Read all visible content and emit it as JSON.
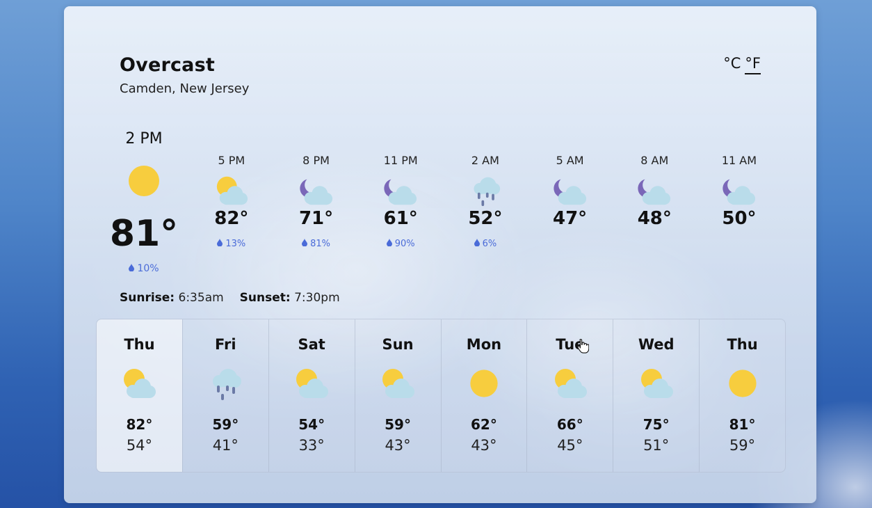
{
  "current": {
    "condition": "Overcast",
    "location": "Camden, New Jersey",
    "time": "2 PM",
    "icon": "sun-icon",
    "temp": "81°",
    "precip": "10%"
  },
  "units": {
    "celsius": "°C",
    "fahrenheit": "°F",
    "selected": "°F"
  },
  "hourly": [
    {
      "time": "5 PM",
      "icon": "partly-cloudy-day-icon",
      "temp": "82°",
      "precip": "13%"
    },
    {
      "time": "8 PM",
      "icon": "partly-cloudy-night-icon",
      "temp": "71°",
      "precip": "81%"
    },
    {
      "time": "11 PM",
      "icon": "partly-cloudy-night-icon",
      "temp": "61°",
      "precip": "90%"
    },
    {
      "time": "2 AM",
      "icon": "rain-icon",
      "temp": "52°",
      "precip": "6%"
    },
    {
      "time": "5 AM",
      "icon": "partly-cloudy-night-icon",
      "temp": "47°",
      "precip": ""
    },
    {
      "time": "8 AM",
      "icon": "partly-cloudy-night-icon",
      "temp": "48°",
      "precip": ""
    },
    {
      "time": "11 AM",
      "icon": "partly-cloudy-night-icon",
      "temp": "50°",
      "precip": ""
    }
  ],
  "sun": {
    "sunrise_label": "Sunrise:",
    "sunrise": "6:35am",
    "sunset_label": "Sunset:",
    "sunset": "7:30pm"
  },
  "daily": [
    {
      "day": "Thu",
      "icon": "partly-cloudy-day-icon",
      "high": "82°",
      "low": "54°"
    },
    {
      "day": "Fri",
      "icon": "rain-icon",
      "high": "59°",
      "low": "41°"
    },
    {
      "day": "Sat",
      "icon": "partly-cloudy-day-icon",
      "high": "54°",
      "low": "33°"
    },
    {
      "day": "Sun",
      "icon": "partly-cloudy-day-icon",
      "high": "59°",
      "low": "43°"
    },
    {
      "day": "Mon",
      "icon": "sun-icon",
      "high": "62°",
      "low": "43°"
    },
    {
      "day": "Tue",
      "icon": "partly-cloudy-day-icon",
      "high": "66°",
      "low": "45°"
    },
    {
      "day": "Wed",
      "icon": "partly-cloudy-day-icon",
      "high": "75°",
      "low": "51°"
    },
    {
      "day": "Thu",
      "icon": "sun-icon",
      "high": "81°",
      "low": "59°"
    }
  ],
  "colors": {
    "sun": "#f7cd3e",
    "cloud": "#b9dcea",
    "moon": "#7a67b8",
    "rain": "#6b7aa6",
    "precip": "#4a6bd8"
  }
}
